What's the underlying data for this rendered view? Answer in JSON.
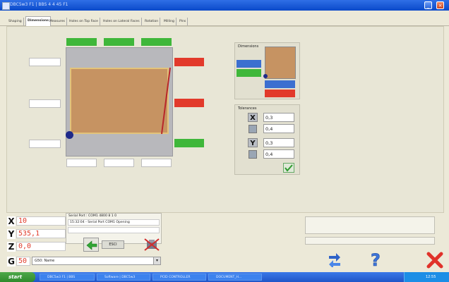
{
  "window": {
    "title": "DBC5w3 F1 | BBS 4 4 45 F1",
    "min_label": "_",
    "close_label": "×"
  },
  "tabs": [
    {
      "label": "Shaping"
    },
    {
      "label": "Dimensions"
    },
    {
      "label": "Measures"
    },
    {
      "label": "Holes on Top Face"
    },
    {
      "label": "Holes on Lateral Faces"
    },
    {
      "label": "Rotation"
    },
    {
      "label": "Milling"
    },
    {
      "label": "Pins"
    }
  ],
  "active_tab": "Dimensions",
  "dimensions_panel": {
    "title": "Dimensions",
    "fields": [
      "",
      "",
      ""
    ]
  },
  "tolerances_panel": {
    "title": "Tolerances",
    "x_label": "X",
    "y_label": "Y",
    "x_plus": "0,3",
    "x_minus": "0,4",
    "y_plus": "0,3",
    "y_minus": "0,4"
  },
  "coordinates": {
    "x_label": "X",
    "x_value": "10",
    "y_label": "Y",
    "y_value": "535,1",
    "z_label": "Z",
    "z_value": "0,0",
    "g_label": "G",
    "g_value": "50"
  },
  "g_select": {
    "value": "G50: Name"
  },
  "serial": {
    "header": "Serial Port : COM1 4800 8 1 0",
    "log_line": "15:32:04 - Serial Port COM1 Opening"
  },
  "controls": {
    "status_button": "ESCI"
  },
  "taskbar": {
    "start_label": "start",
    "items": [
      "DBC5w3 F1 | BBS",
      "Software | DBC5w3",
      "PCID CONTROLLER",
      "DOCUMENT_H..."
    ],
    "tray_time": "12:55"
  },
  "colors": {
    "plate": "#c69362",
    "accent_green": "#3fb73a",
    "accent_red": "#e23a2b",
    "title_blue": "#0a49c9"
  },
  "icons": {
    "ok": "check-icon",
    "refresh": "refresh-icon",
    "help": "question-icon",
    "exit": "close-icon"
  }
}
